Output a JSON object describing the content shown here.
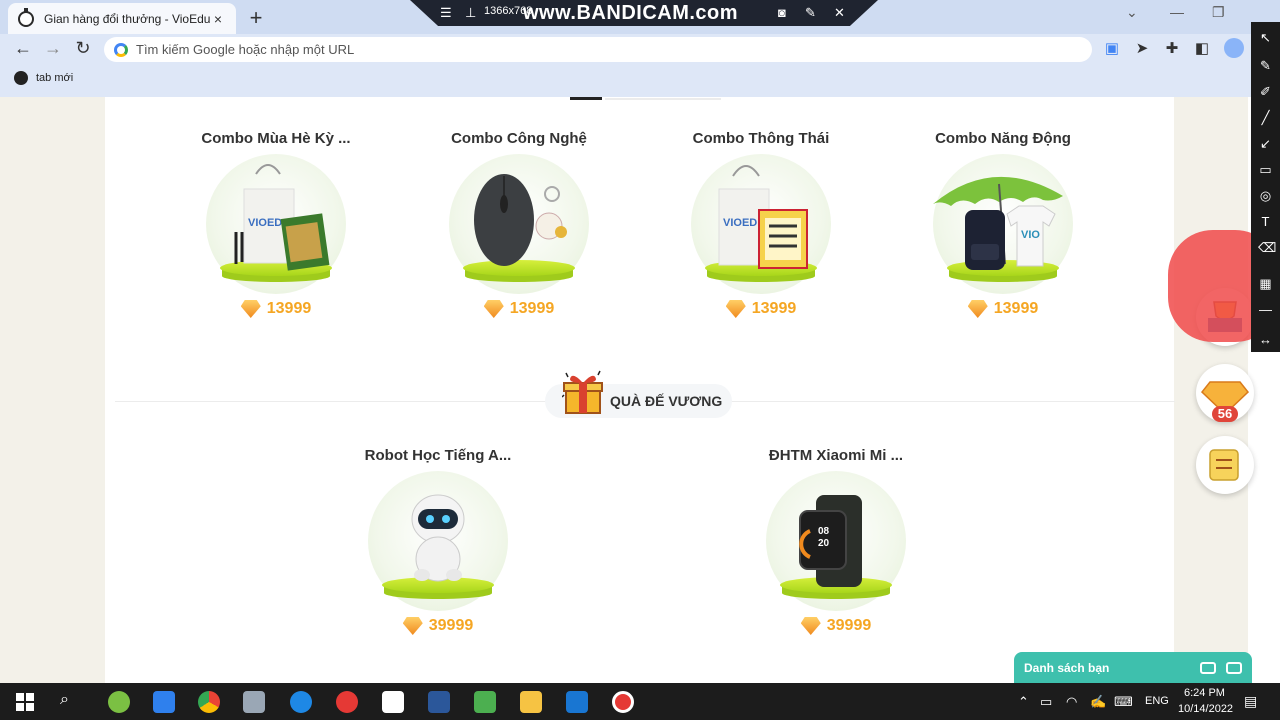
{
  "browser": {
    "tab_title": "Gian hàng đổi thưởng - VioEdu",
    "tab_close": "×",
    "new_tab": "+",
    "omnibox_placeholder": "Tìm kiếm Google hoặc nhập một URL",
    "bookmark_label": "tab mới"
  },
  "recorder": {
    "resolution": "1366x768",
    "watermark": "www.BANDICAM.com"
  },
  "section_top": {
    "products": [
      {
        "name": "Combo Mùa Hè Kỳ ...",
        "price": "13999",
        "item_icon": "tote-bag-earphones-book-icon"
      },
      {
        "name": "Combo Công Nghệ",
        "price": "13999",
        "item_icon": "mouse-keychain-icon"
      },
      {
        "name": "Combo Thông Thái",
        "price": "13999",
        "item_icon": "tote-bag-book-icon"
      },
      {
        "name": "Combo Năng Động",
        "price": "13999",
        "item_icon": "umbrella-backpack-shirt-icon"
      }
    ]
  },
  "section_special": {
    "title": "QUÀ ĐẾ VƯƠNG",
    "products": [
      {
        "name": "Robot Học Tiếng A...",
        "price": "39999",
        "item_icon": "robot-icon"
      },
      {
        "name": "ĐHTM Xiaomi Mi ...",
        "price": "39999",
        "item_icon": "smartwatch-icon"
      }
    ]
  },
  "sidebar": {
    "gem_count": "56"
  },
  "friends_bar": {
    "label": "Danh sách bạn"
  },
  "watch_time": "08\n20",
  "taskbar": {
    "language": "ENG",
    "time": "6:24 PM",
    "date": "10/14/2022"
  },
  "colors": {
    "price": "#f5a623",
    "friends_bar": "#3ec0ad",
    "pedestal": "#c4e42e"
  }
}
